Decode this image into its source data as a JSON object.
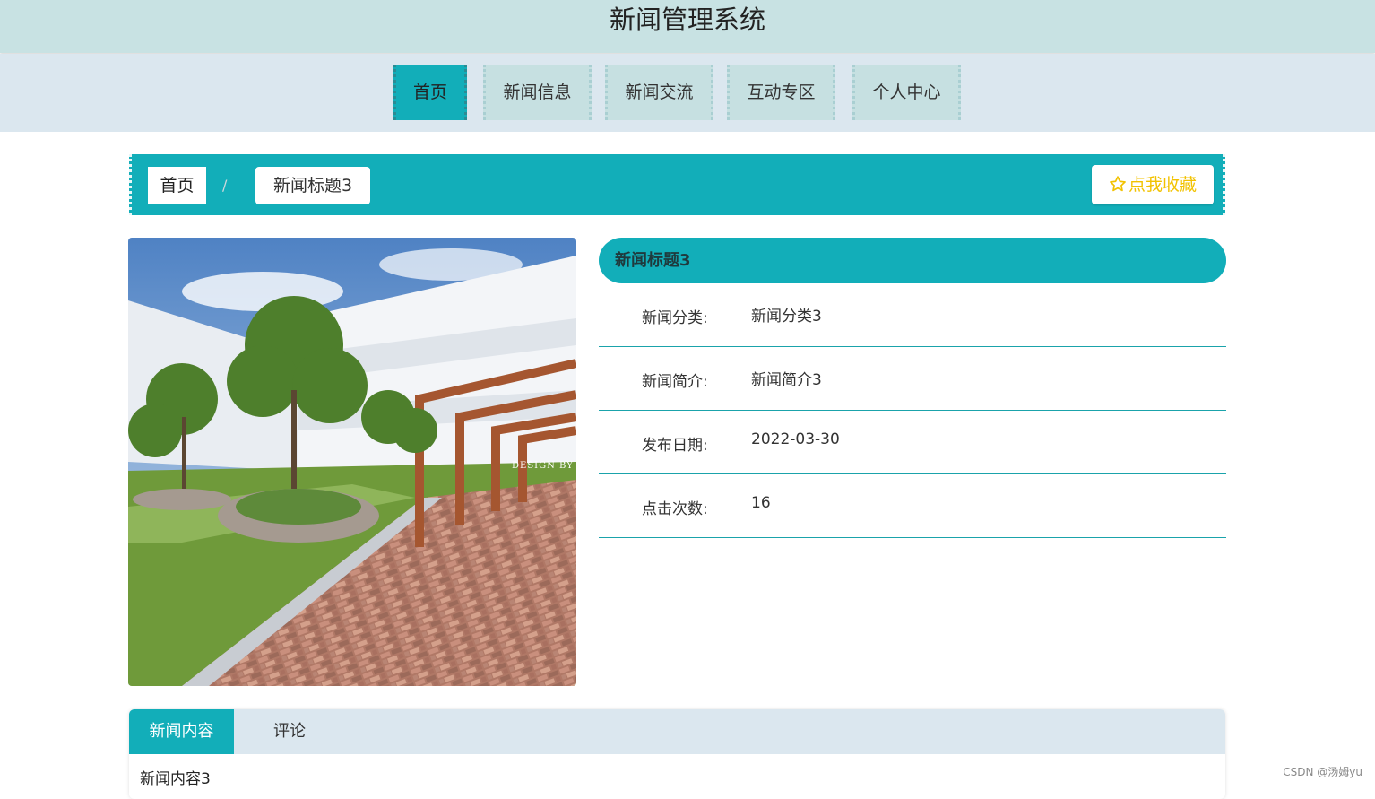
{
  "header": {
    "title": "新闻管理系统"
  },
  "nav": {
    "items": [
      {
        "label": "首页",
        "active": true
      },
      {
        "label": "新闻信息",
        "active": false
      },
      {
        "label": "新闻交流",
        "active": false
      },
      {
        "label": "互动专区",
        "active": false
      },
      {
        "label": "个人中心",
        "active": false
      }
    ]
  },
  "breadcrumb": {
    "home": "首页",
    "separator": "/",
    "current": "新闻标题3"
  },
  "favorite": {
    "label": "点我收藏",
    "icon": "star-outline-icon",
    "color": "#f2c200"
  },
  "detail": {
    "title": "新闻标题3",
    "rows": [
      {
        "label": "新闻分类:",
        "value": "新闻分类3"
      },
      {
        "label": "新闻简介:",
        "value": "新闻简介3"
      },
      {
        "label": "发布日期:",
        "value": "2022-03-30"
      },
      {
        "label": "点击次数:",
        "value": "16"
      }
    ]
  },
  "image": {
    "overlay_text": "DESIGN BY"
  },
  "tabs": {
    "items": [
      {
        "label": "新闻内容",
        "active": true
      },
      {
        "label": "评论",
        "active": false
      }
    ],
    "content": "新闻内容3"
  },
  "watermark": "CSDN @汤姆yu",
  "colors": {
    "accent": "#12aeb9",
    "header_bg": "#c8e2e3",
    "nav_bg": "#dbe7ef"
  }
}
